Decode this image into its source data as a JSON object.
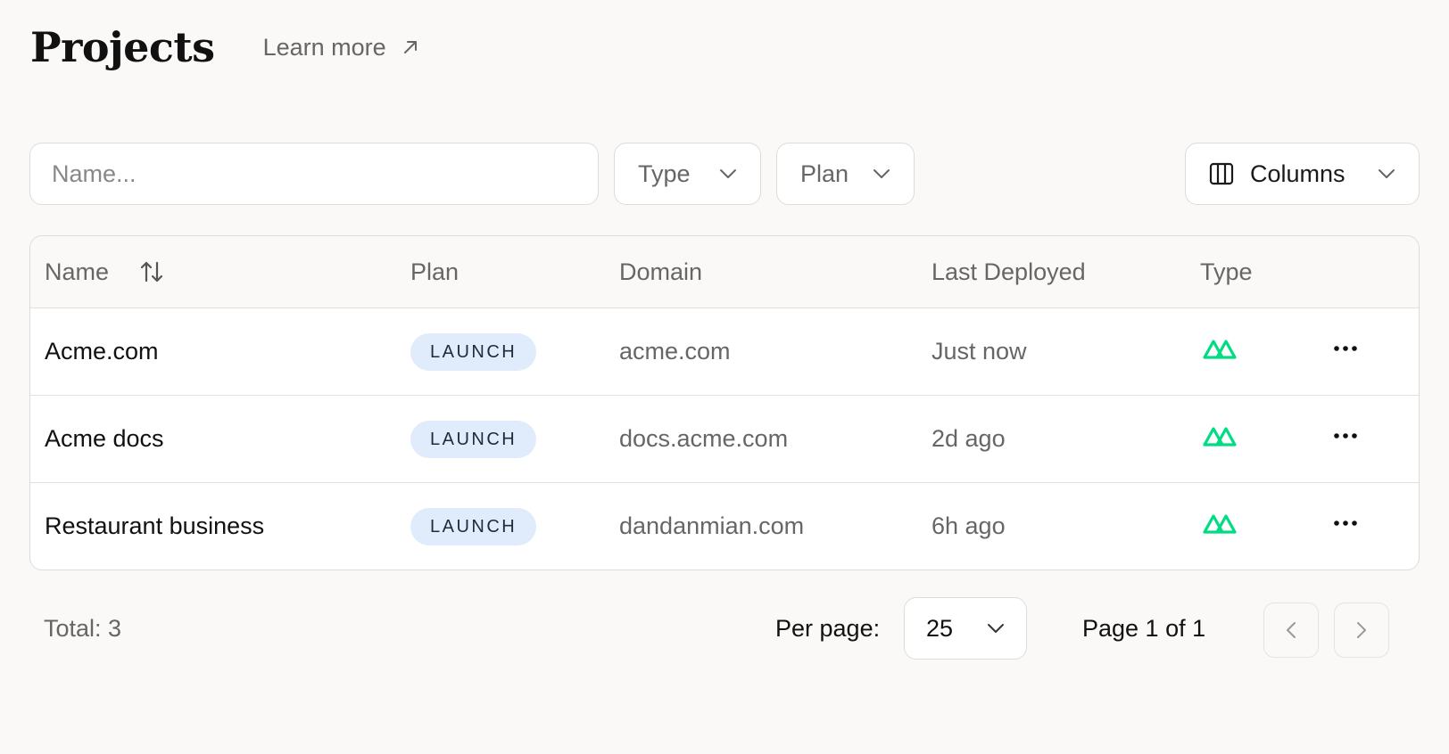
{
  "header": {
    "title": "Projects",
    "learn_more": "Learn more"
  },
  "filters": {
    "search_placeholder": "Name...",
    "type_label": "Type",
    "plan_label": "Plan",
    "columns_label": "Columns"
  },
  "table": {
    "columns": [
      "Name",
      "Plan",
      "Domain",
      "Last Deployed",
      "Type"
    ],
    "rows": [
      {
        "name": "Acme.com",
        "plan": "LAUNCH",
        "domain": "acme.com",
        "deployed": "Just now",
        "type_icon": "nuxt-icon"
      },
      {
        "name": "Acme docs",
        "plan": "LAUNCH",
        "domain": "docs.acme.com",
        "deployed": "2d ago",
        "type_icon": "nuxt-icon"
      },
      {
        "name": "Restaurant business",
        "plan": "LAUNCH",
        "domain": "dandanmian.com",
        "deployed": "6h ago",
        "type_icon": "nuxt-icon"
      }
    ]
  },
  "footer": {
    "total": "Total: 3",
    "per_page_label": "Per page:",
    "per_page_value": "25",
    "page_info": "Page 1 of 1"
  },
  "colors": {
    "background": "#faf9f7",
    "badge_bg": "#e0ecfb",
    "type_icon": "#00dc82"
  }
}
